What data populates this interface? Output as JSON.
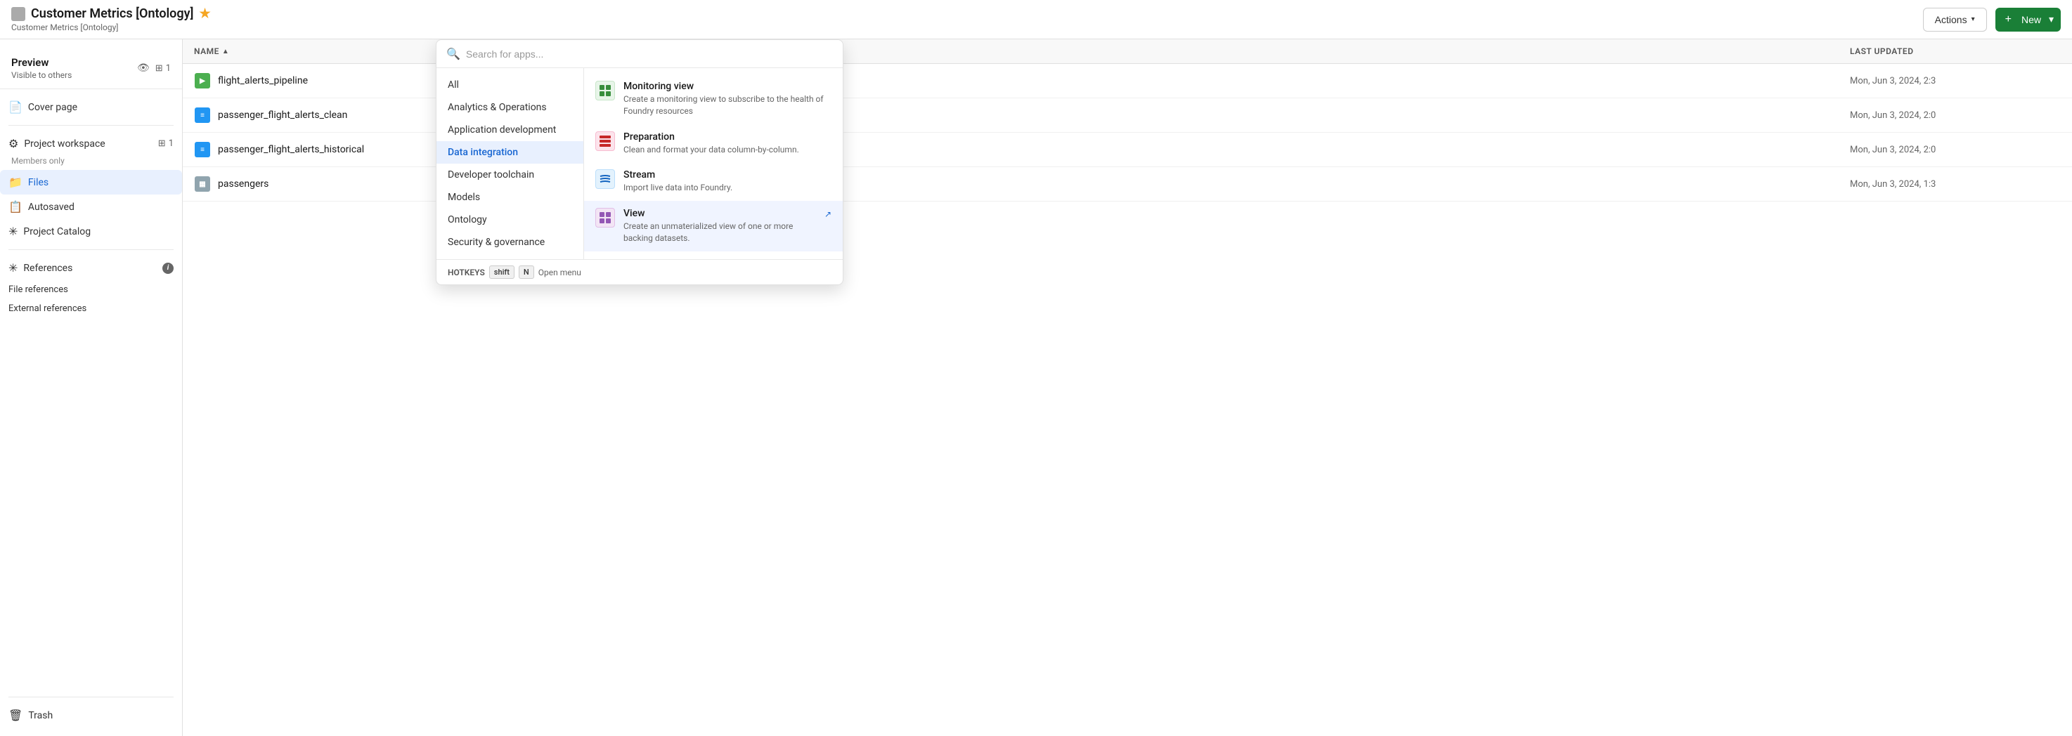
{
  "header": {
    "title": "Customer Metrics [Ontology]",
    "subtitle": "Customer Metrics [Ontology]",
    "actions_label": "Actions",
    "new_label": "New"
  },
  "sidebar": {
    "preview_label": "Preview",
    "preview_subtitle": "Visible to others",
    "preview_count": "1",
    "cover_page_label": "Cover page",
    "project_workspace_label": "Project workspace",
    "project_workspace_subtitle": "Members only",
    "project_workspace_count": "1",
    "files_label": "Files",
    "autosaved_label": "Autosaved",
    "project_catalog_label": "Project Catalog",
    "references_label": "References",
    "file_references_label": "File references",
    "external_references_label": "External references",
    "trash_label": "Trash"
  },
  "table": {
    "col_name": "NAME",
    "col_updated": "LAST UPDATED",
    "rows": [
      {
        "name": "flight_alerts_pipeline",
        "updated": "Mon, Jun 3, 2024, 2:3",
        "icon_type": "pipeline"
      },
      {
        "name": "passenger_flight_alerts_clean",
        "updated": "Mon, Jun 3, 2024, 2:0",
        "icon_type": "dataset"
      },
      {
        "name": "passenger_flight_alerts_historical",
        "updated": "Mon, Jun 3, 2024, 2:0",
        "icon_type": "dataset"
      },
      {
        "name": "passengers",
        "updated": "Mon, Jun 3, 2024, 1:3",
        "icon_type": "table"
      }
    ]
  },
  "dropdown": {
    "search_placeholder": "Search for apps...",
    "categories": [
      {
        "id": "all",
        "label": "All",
        "active": false
      },
      {
        "id": "analytics",
        "label": "Analytics & Operations",
        "active": false
      },
      {
        "id": "application",
        "label": "Application development",
        "active": false
      },
      {
        "id": "data_integration",
        "label": "Data integration",
        "active": true
      },
      {
        "id": "developer",
        "label": "Developer toolchain",
        "active": false
      },
      {
        "id": "models",
        "label": "Models",
        "active": false
      },
      {
        "id": "ontology",
        "label": "Ontology",
        "active": false
      },
      {
        "id": "security",
        "label": "Security & governance",
        "active": false
      }
    ],
    "apps": [
      {
        "id": "monitoring",
        "title": "Monitoring view",
        "description": "Create a monitoring view to subscribe to the health of Foundry resources",
        "icon_type": "monitoring",
        "icon_symbol": "▦"
      },
      {
        "id": "preparation",
        "title": "Preparation",
        "description": "Clean and format your data column-by-column.",
        "icon_type": "preparation",
        "icon_symbol": "⊞"
      },
      {
        "id": "stream",
        "title": "Stream",
        "description": "Import live data into Foundry.",
        "icon_type": "stream",
        "icon_symbol": "≋"
      },
      {
        "id": "view",
        "title": "View",
        "description": "Create an unmaterialized view of one or more backing datasets.",
        "icon_type": "view",
        "icon_symbol": "▦",
        "selected": true,
        "has_link": true
      }
    ],
    "hotkeys_label": "HOTKEYS",
    "hotkey_shift": "shift",
    "hotkey_n": "N",
    "hotkey_action": "Open menu"
  }
}
